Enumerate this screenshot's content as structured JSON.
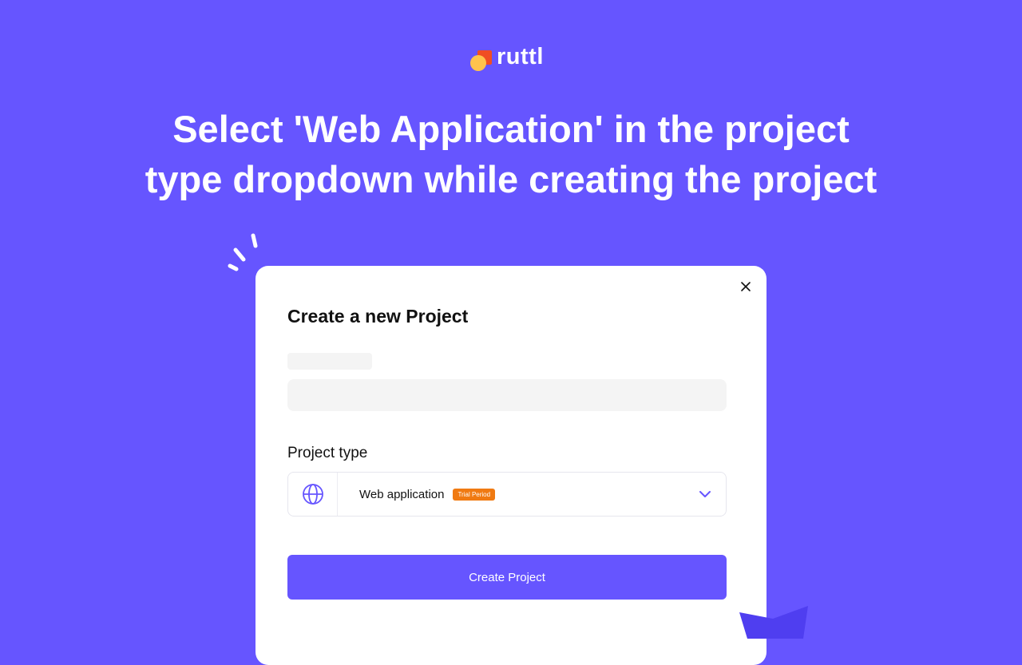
{
  "brand": {
    "name": "ruttl",
    "colors": {
      "background": "#6655ff",
      "logo_square": "#f04d23",
      "logo_circle": "#ffc34d",
      "badge": "#f07a12"
    }
  },
  "headline": {
    "line1": "Select 'Web Application' in the project",
    "line2": "type dropdown while creating the project"
  },
  "modal": {
    "title": "Create a new Project",
    "close_icon": "close-icon",
    "project_type": {
      "label": "Project type",
      "selected_value": "Web application",
      "selected_icon": "globe-icon",
      "badge": "Trial Period",
      "dropdown_icon": "chevron-down-icon"
    },
    "submit_label": "Create Project"
  }
}
